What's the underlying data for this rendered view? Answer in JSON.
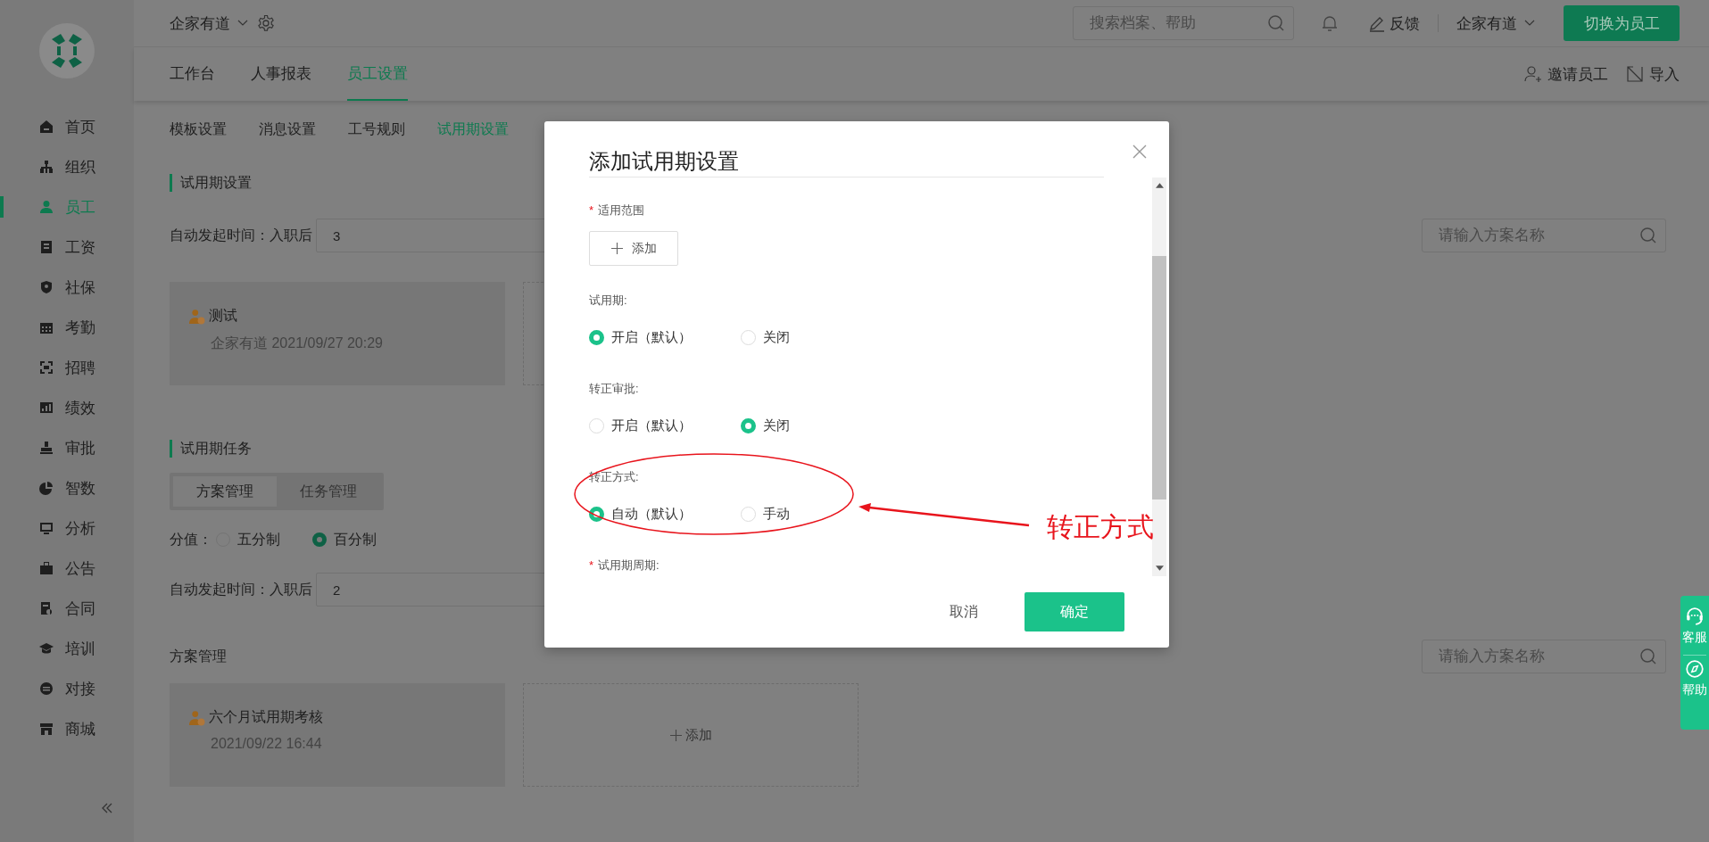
{
  "sidebar": {
    "items": [
      {
        "label": "首页",
        "selected": false
      },
      {
        "label": "组织",
        "selected": false
      },
      {
        "label": "员工",
        "selected": true
      },
      {
        "label": "工资",
        "selected": false
      },
      {
        "label": "社保",
        "selected": false
      },
      {
        "label": "考勤",
        "selected": false
      },
      {
        "label": "招聘",
        "selected": false
      },
      {
        "label": "绩效",
        "selected": false
      },
      {
        "label": "审批",
        "selected": false
      },
      {
        "label": "智数",
        "selected": false
      },
      {
        "label": "分析",
        "selected": false
      },
      {
        "label": "公告",
        "selected": false
      },
      {
        "label": "合同",
        "selected": false
      },
      {
        "label": "培训",
        "selected": false
      },
      {
        "label": "对接",
        "selected": false
      },
      {
        "label": "商城",
        "selected": false
      }
    ]
  },
  "topbar": {
    "company": "企家有道",
    "search": {
      "placeholder": "搜索档案、帮助"
    },
    "feedback": "反馈",
    "account": "企家有道",
    "switch_button": "切换为员工"
  },
  "tabs": [
    {
      "label": "工作台",
      "selected": false
    },
    {
      "label": "人事报表",
      "selected": false
    },
    {
      "label": "员工设置",
      "selected": true
    }
  ],
  "actions": [
    "邀请员工",
    "导入"
  ],
  "subtabs": [
    {
      "label": "模板设置",
      "selected": false
    },
    {
      "label": "消息设置",
      "selected": false
    },
    {
      "label": "工号规则",
      "selected": false
    },
    {
      "label": "试用期设置",
      "selected": true
    }
  ],
  "probation_settings": {
    "title": "试用期设置",
    "trigger_label": "自动发起时间：入职后",
    "trigger_value": "3",
    "search": {
      "placeholder": "请输入方案名称"
    },
    "cards": [
      {
        "title": "测试",
        "subtitle": "企家有道 2021/09/27 20:29"
      }
    ]
  },
  "probation_tasks": {
    "title": "试用期任务",
    "segments": [
      {
        "label": "方案管理",
        "selected": true
      },
      {
        "label": "任务管理",
        "selected": false
      }
    ],
    "score_label": "分值：",
    "score_options": [
      {
        "label": "五分制",
        "selected": false
      },
      {
        "label": "百分制",
        "selected": true
      }
    ],
    "trigger_label": "自动发起时间：入职后",
    "trigger_value": "2",
    "plans_title": "方案管理",
    "search": {
      "placeholder": "请输入方案名称"
    },
    "cards": [
      {
        "title": "六个月试用期考核",
        "subtitle": "2021/09/22 16:44"
      }
    ],
    "add_label": "添加"
  },
  "modal": {
    "title": "添加试用期设置",
    "fields": [
      {
        "kind": "add",
        "mark": "*",
        "label": "适用范围",
        "button": "添加"
      },
      {
        "kind": "radio",
        "label": "试用期:",
        "options": [
          {
            "label": "开启（默认）",
            "selected": true
          },
          {
            "label": "关闭",
            "selected": false
          }
        ]
      },
      {
        "kind": "radio",
        "label": "转正审批:",
        "options": [
          {
            "label": "开启（默认）",
            "selected": false
          },
          {
            "label": "关闭",
            "selected": true
          }
        ]
      },
      {
        "kind": "radio",
        "label": "转正方式:",
        "options": [
          {
            "label": "自动（默认）",
            "selected": true
          },
          {
            "label": "手动",
            "selected": false
          }
        ]
      },
      {
        "kind": "label",
        "mark": "*",
        "label": "试用期周期:"
      }
    ],
    "cancel": "取消",
    "confirm": "确定"
  },
  "annotation": {
    "label": "转正方式"
  },
  "float_widget": [
    "客服",
    "帮助"
  ]
}
